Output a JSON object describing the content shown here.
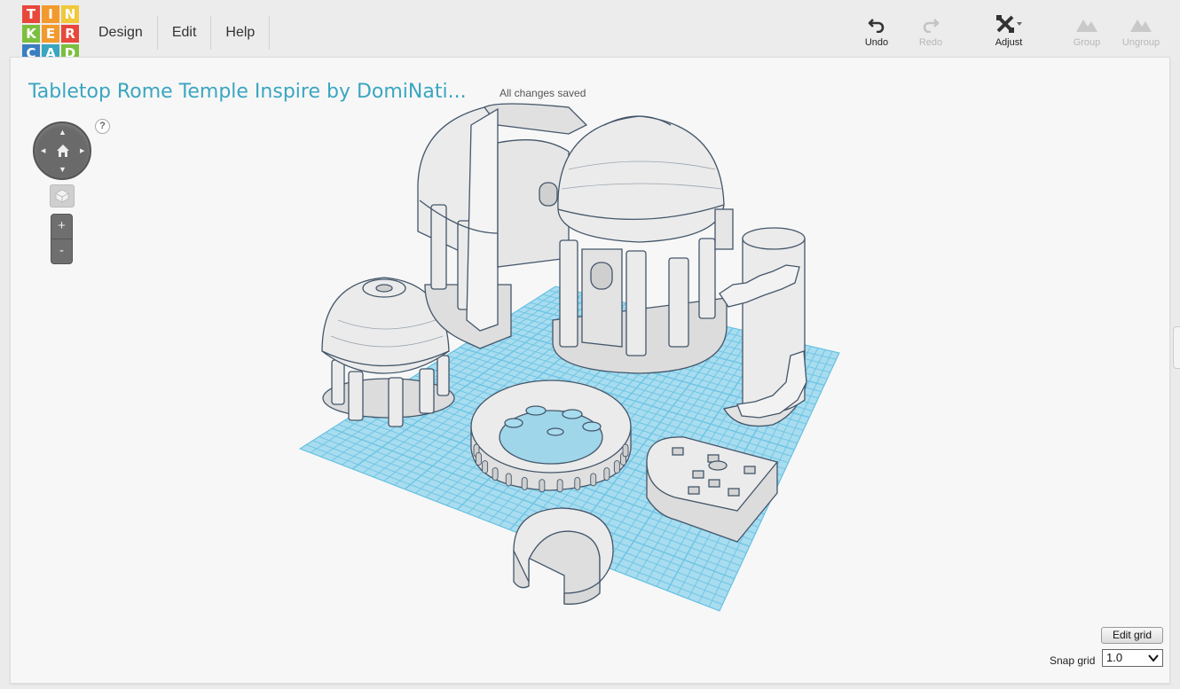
{
  "app": {
    "logo_letters": [
      "T",
      "I",
      "N",
      "K",
      "E",
      "R",
      "C",
      "A",
      "D"
    ],
    "logo_colors": [
      "#e8473b",
      "#f29a2e",
      "#f0c83a",
      "#7cbf3f",
      "#f29a2e",
      "#e8473b",
      "#3a7fbf",
      "#3aa6c0",
      "#7cbf3f"
    ]
  },
  "menu": {
    "design": "Design",
    "edit": "Edit",
    "help": "Help"
  },
  "toolbar": {
    "undo": "Undo",
    "redo": "Redo",
    "adjust": "Adjust",
    "group": "Group",
    "ungroup": "Ungroup"
  },
  "document": {
    "title": "Tabletop Rome Temple Inspire by DomiNati...",
    "save_status": "All changes saved"
  },
  "view_controls": {
    "help": "?",
    "zoom_in": "+",
    "zoom_out": "-"
  },
  "grid": {
    "edit_label": "Edit grid",
    "snap_label": "Snap grid",
    "snap_value": "1.0"
  },
  "colors": {
    "accent": "#3aa6c0",
    "workplane": "#9fd8ec",
    "workplane_grid": "#5cbde0",
    "model": "#e9e9e9",
    "model_edge": "#4a5a6a"
  },
  "icons": [
    "undo-icon",
    "redo-icon",
    "adjust-icon",
    "group-icon",
    "ungroup-icon",
    "home-icon",
    "view-cube-icon"
  ]
}
